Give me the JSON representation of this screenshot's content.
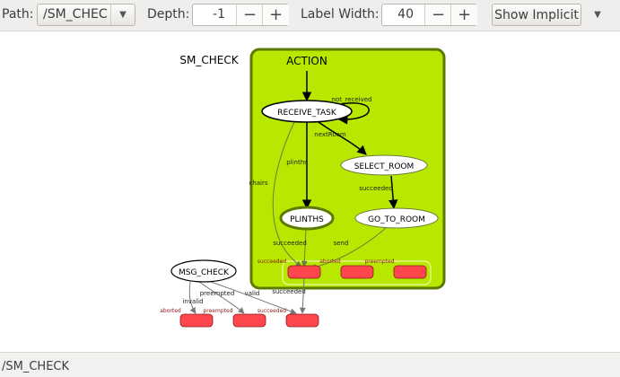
{
  "toolbar": {
    "path_label": "Path:",
    "path_value": "/SM_CHEC",
    "depth_label": "Depth:",
    "depth_value": "-1",
    "label_width_label": "Label Width:",
    "label_width_value": "40",
    "minus": "−",
    "plus": "+",
    "show_implicit": "Show Implicit",
    "dropdown_icon": "chevron-down-icon"
  },
  "graph": {
    "root_label": "SM_CHECK",
    "container_label": "ACTION",
    "states": {
      "receive_task": "RECEIVE_TASK",
      "select_room": "SELECT_ROOM",
      "plinths": "PLINTHS",
      "go_to_room": "GO_TO_ROOM",
      "msg_check": "MSG_CHECK"
    },
    "edges": {
      "not_received": "not_received",
      "next_room": "nextRoom",
      "plinths": "plinths",
      "chairs": "chairs",
      "succeeded": "succeeded",
      "send": "send",
      "invalid": "invalid",
      "preempted": "preempted",
      "valid": "valid"
    },
    "outcomes": {
      "succeeded": "succeeded",
      "aborted": "aborted",
      "preempted": "preempted"
    },
    "colors": {
      "container_fill": "#b8e800",
      "container_stroke": "#5c7a00",
      "outcome_fill": "#fe464f",
      "outcome_label": "#8b1a1a"
    }
  },
  "status": {
    "path": "/SM_CHECK"
  }
}
